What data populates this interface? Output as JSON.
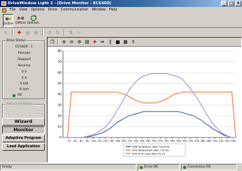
{
  "window": {
    "title": "DriveWindow Light 2 - [Drive Monitor - ECS400]",
    "btn_min": "_",
    "btn_max": "□",
    "btn_close": "×"
  },
  "menu": [
    "File",
    "View",
    "Options",
    "Drive",
    "Communication",
    "Window",
    "Help"
  ],
  "toolbar": {
    "online_label": "Online",
    "offline_label": "Offline",
    "refresh_label": "Refresh"
  },
  "drive_status": {
    "title": "Drive Status",
    "model": "ECS400 : 1",
    "control": "Remote",
    "state": "Stopped",
    "direction": "Reverse",
    "v1": "0 V",
    "a1": "0 A",
    "kw": "0 kW",
    "rpm": "0 rpm",
    "ok": "OK"
  },
  "advanced_status": {
    "title": "Advanced Status"
  },
  "side_buttons": [
    "Wizard",
    "Monitor",
    "Adaptive Program",
    "Load Application"
  ],
  "chart_data": {
    "type": "line",
    "ylim": [
      0,
      80
    ],
    "yticks": [
      0,
      10,
      20,
      30,
      40,
      50,
      60,
      70,
      80
    ],
    "xticks": [
      "2s",
      "4s",
      "6s",
      "8s",
      "10s",
      "12s",
      "14s",
      "16s",
      "18s",
      "20s",
      "22s",
      "24s",
      "26s",
      "28s",
      "30s",
      "32s",
      "34s",
      "36s",
      "38s",
      "40s",
      "42s",
      "44s",
      "46s",
      "48s",
      "50s",
      "52s",
      "54s",
      "56s"
    ],
    "legend_placement": "bottom-center",
    "series": [
      {
        "name": "408 FieldStren Idev *100.00",
        "color": "#1f3f8c",
        "values": [
          0,
          0,
          0,
          0,
          0,
          0,
          1,
          1,
          2,
          3,
          4,
          6,
          8,
          11,
          14,
          16,
          18,
          20,
          21,
          22,
          23,
          24,
          24,
          24,
          24,
          24,
          24,
          24,
          24,
          24,
          24,
          23,
          22,
          21,
          20,
          18,
          16,
          13,
          11,
          8,
          6,
          4,
          2,
          1,
          0,
          0
        ]
      },
      {
        "name": "309 AbsErosion Idev *10.00",
        "color": "#e06010",
        "values": [
          0,
          0,
          42,
          42,
          42,
          42,
          42,
          42,
          42,
          42,
          42,
          42,
          42,
          42,
          42,
          41,
          40,
          38,
          36,
          34,
          33,
          32,
          32,
          32,
          32,
          33,
          34,
          36,
          38,
          40,
          41,
          42,
          42,
          42,
          42,
          42,
          42,
          42,
          42,
          42,
          42,
          42,
          42,
          42,
          42,
          0
        ]
      },
      {
        "name": "505 Unit Load Idev *0.10",
        "color": "#9a70c8",
        "values": [
          0,
          0,
          0,
          0,
          0,
          0,
          1,
          2,
          3,
          5,
          7,
          10,
          14,
          19,
          25,
          31,
          37,
          43,
          48,
          52,
          55,
          57,
          58,
          59,
          59,
          59,
          59,
          59,
          58,
          57,
          56,
          54,
          50,
          46,
          41,
          36,
          30,
          24,
          18,
          13,
          9,
          5,
          3,
          1,
          0,
          0
        ]
      }
    ]
  },
  "status": {
    "ready": "Ready",
    "drive_ok": "Drive OK",
    "connection_ok": "Connection OK"
  },
  "colors": {
    "title_bar": "#0a246a",
    "background": "#d4d0c8",
    "led_ok": "#18c018"
  }
}
